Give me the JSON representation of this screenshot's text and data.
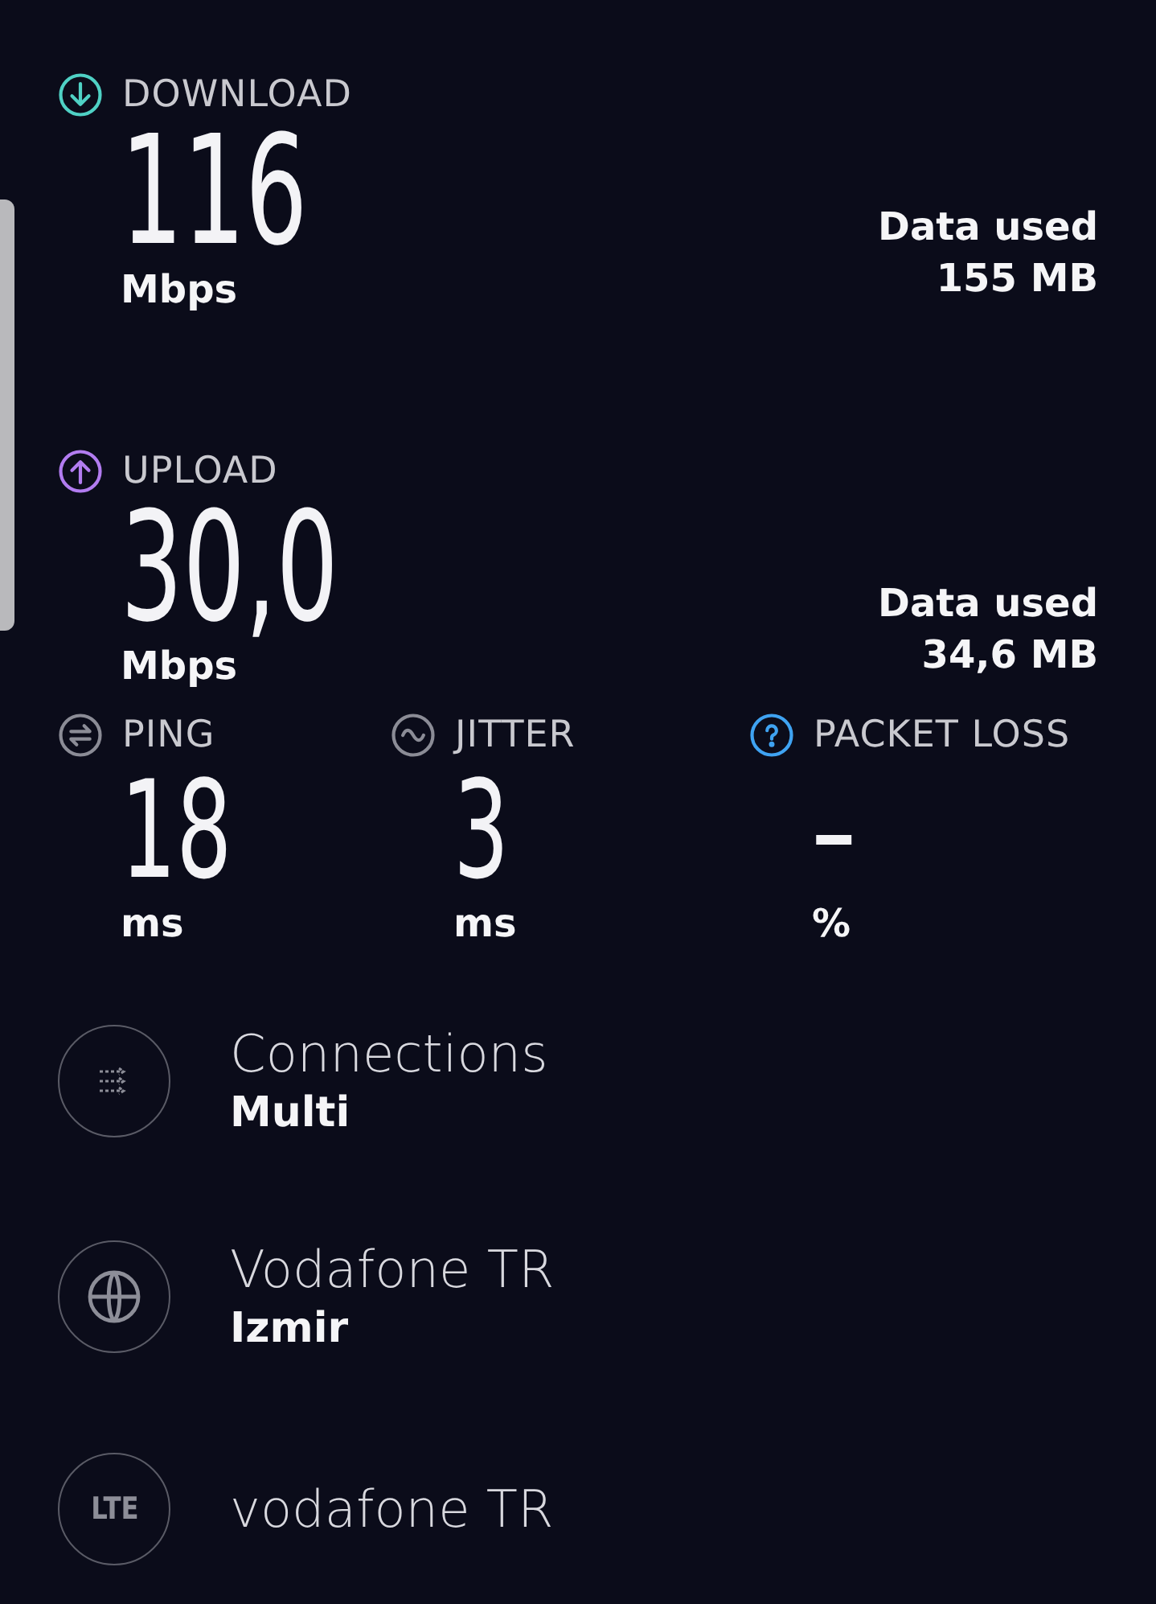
{
  "speeds": [
    {
      "kind": "download",
      "label": "DOWNLOAD",
      "value": "116",
      "unit": "Mbps",
      "data_used_label": "Data used",
      "data_used": "155 MB"
    },
    {
      "kind": "upload",
      "label": "UPLOAD",
      "value": "30,0",
      "unit": "Mbps",
      "data_used_label": "Data used",
      "data_used": "34,6 MB"
    }
  ],
  "metrics": [
    {
      "kind": "ping",
      "label": "PING",
      "value": "18",
      "unit": "ms"
    },
    {
      "kind": "jitter",
      "label": "JITTER",
      "value": "3",
      "unit": "ms"
    },
    {
      "kind": "packet_loss",
      "label": "PACKET LOSS",
      "value": "–",
      "unit": "%"
    }
  ],
  "details": [
    {
      "kind": "connections",
      "title": "Connections",
      "subtitle": "Multi"
    },
    {
      "kind": "server",
      "title": "Vodafone TR",
      "subtitle": "Izmir"
    },
    {
      "kind": "network",
      "badge": "LTE",
      "title": "vodafone TR"
    }
  ]
}
